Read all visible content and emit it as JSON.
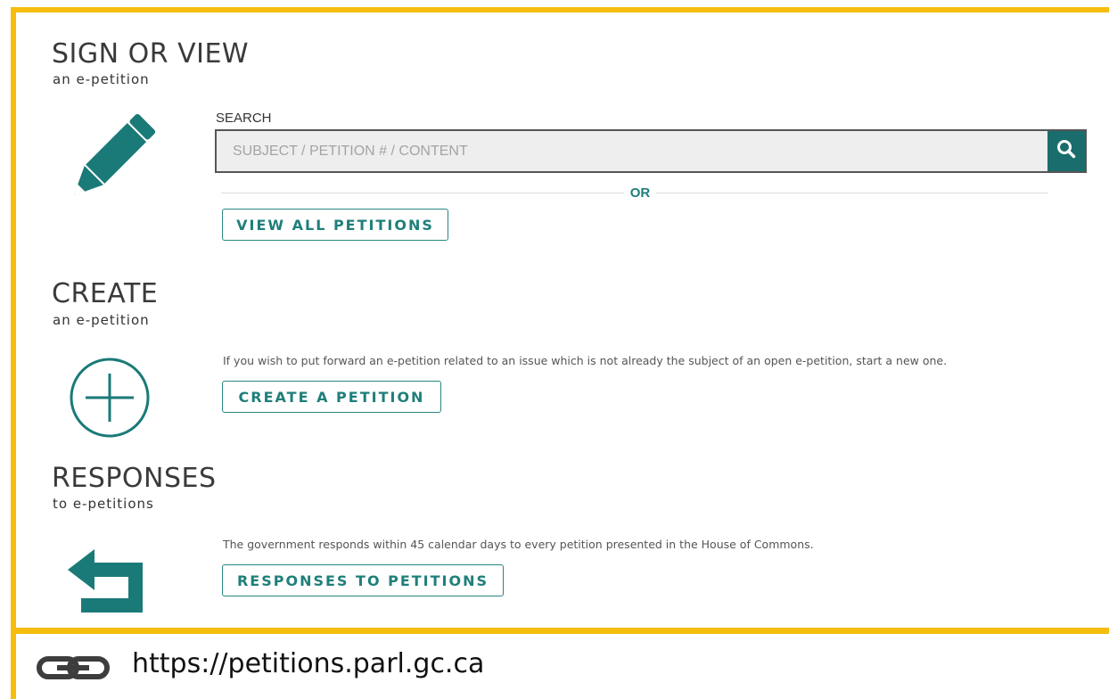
{
  "sections": {
    "sign": {
      "title": "SIGN OR VIEW",
      "subtitle": "an e-petition",
      "icon": "pencil-icon"
    },
    "create": {
      "title": "CREATE",
      "subtitle": "an e-petition",
      "icon": "plus-circle-icon"
    },
    "responses": {
      "title": "RESPONSES",
      "subtitle": "to e-petitions",
      "icon": "return-arrow-icon"
    }
  },
  "search": {
    "label": "SEARCH",
    "placeholder": "SUBJECT / PETITION # / CONTENT",
    "value": "",
    "button_icon": "search-icon"
  },
  "or_label": "OR",
  "buttons": {
    "view_all": "VIEW ALL PETITIONS",
    "create": "CREATE A PETITION",
    "responses": "RESPONSES TO PETITIONS"
  },
  "descriptions": {
    "create": "If you wish to put forward an e-petition related to an issue which is not already the subject of an open e-petition, start a new one.",
    "responses": "The government responds within 45 calendar days to every petition presented in the House of Commons."
  },
  "footer": {
    "url": "https://petitions.parl.gc.ca",
    "icon": "link-icon"
  },
  "colors": {
    "accent": "#1f7f7a",
    "frame": "#f5bd0e",
    "icon": "#1a7a78"
  }
}
